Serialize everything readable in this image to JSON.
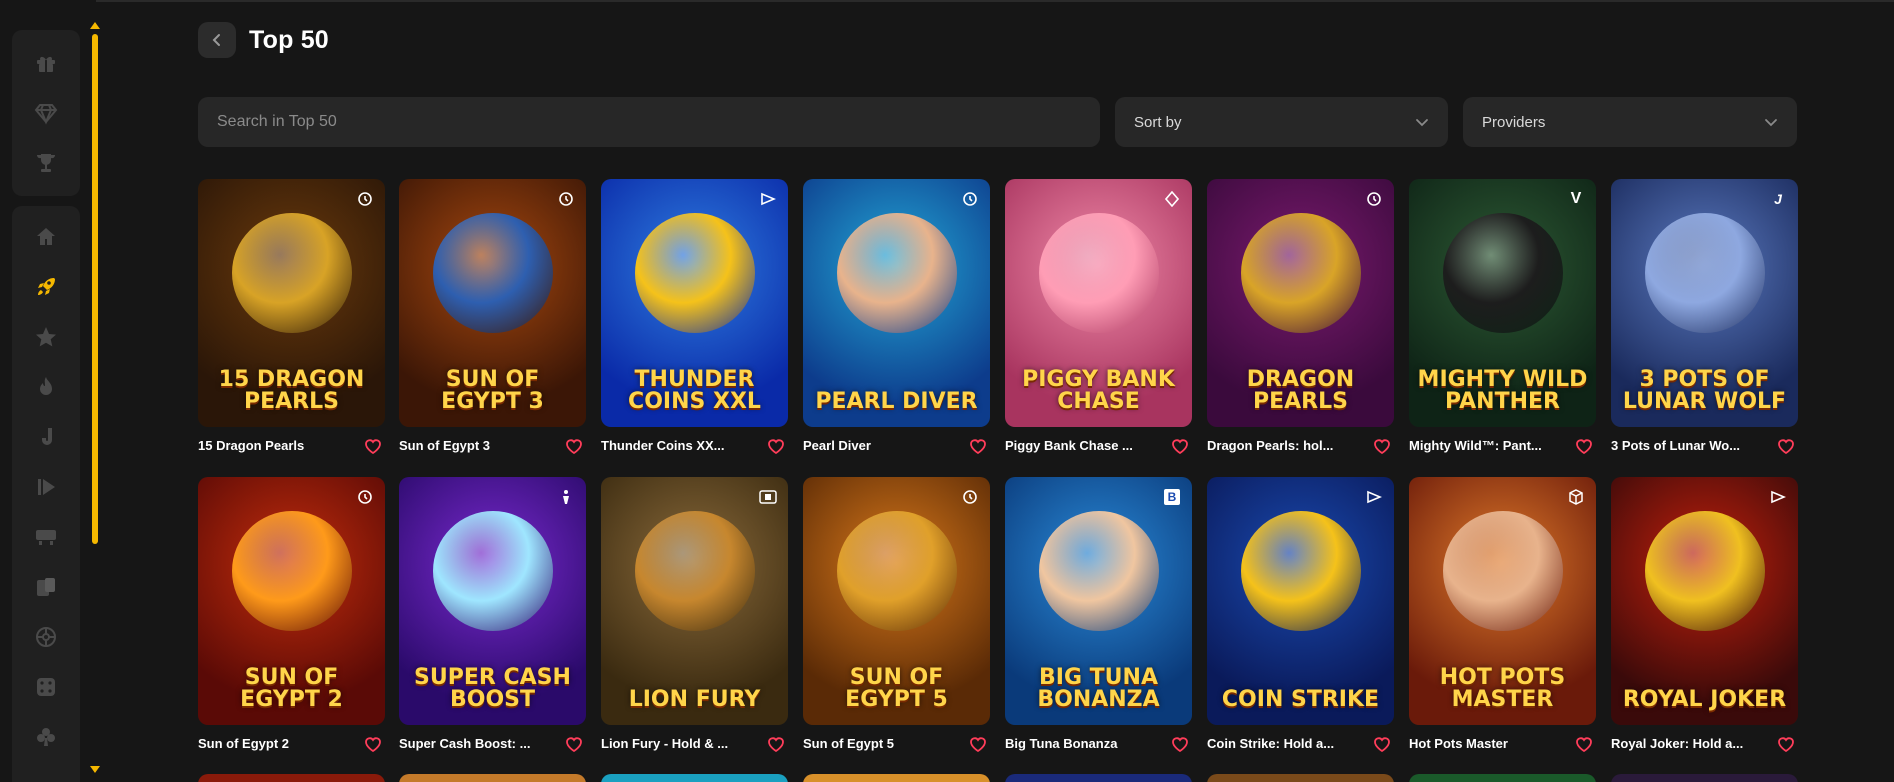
{
  "page": {
    "title": "Top 50"
  },
  "search": {
    "placeholder": "Search in Top 50"
  },
  "filters": {
    "sort_label": "Sort by",
    "providers_label": "Providers"
  },
  "sidebar": {
    "group1": [
      "gift-icon",
      "diamond-icon",
      "trophy-icon"
    ],
    "group2": [
      "home-icon",
      "rocket-icon",
      "star-icon",
      "fire-icon",
      "jackpot-icon",
      "live-icon",
      "table-games-icon",
      "cards-icon",
      "roulette-icon",
      "dice-icon",
      "clubs-icon"
    ],
    "active": "rocket-icon",
    "accent": "#f5b800"
  },
  "games": [
    {
      "name": "15 Dragon Pearls",
      "logo": "15 Dragon Pearls",
      "badge": "replay-icon",
      "bg": "#2a1608",
      "bg2": "#6b3a0b",
      "fig": "#d8a326"
    },
    {
      "name": "Sun of Egypt 3",
      "logo": "Sun of Egypt 3",
      "badge": "replay-icon",
      "bg": "#3b1606",
      "bg2": "#a7480f",
      "fig": "#2e5fb0"
    },
    {
      "name": "Thunder Coins XX...",
      "logo": "Thunder Coins XXL",
      "badge": "play-flag-icon",
      "bg": "#0a2aa8",
      "bg2": "#2f7de0",
      "fig": "#f5c21a"
    },
    {
      "name": "Pearl Diver",
      "logo": "Pearl Diver",
      "badge": "replay-icon",
      "bg": "#0d3c8c",
      "bg2": "#23a7d6",
      "fig": "#e8b38c"
    },
    {
      "name": "Piggy Bank Chase ...",
      "logo": "Piggy Bank Chase",
      "badge": "diamond-outline-icon",
      "bg": "#a8345f",
      "bg2": "#f08aa8",
      "fig": "#ff9db5"
    },
    {
      "name": "Dragon Pearls: hol...",
      "logo": "Dragon Pearls",
      "badge": "replay-icon",
      "bg": "#3a0a3c",
      "bg2": "#7a1a6e",
      "fig": "#d9a427"
    },
    {
      "name": "Mighty Wild™: Pant...",
      "logo": "Mighty Wild Panther",
      "badge": "v-letter-icon",
      "bg": "#0e2316",
      "bg2": "#2d5a34",
      "fig": "#1d1d1d"
    },
    {
      "name": "3 Pots of Lunar Wo...",
      "logo": "3 Pots of Lunar Wolf",
      "badge": "j-letter-icon",
      "bg": "#1a2a5c",
      "bg2": "#5b7ac0",
      "fig": "#8ea8e0"
    },
    {
      "name": "Sun of Egypt 2",
      "logo": "Sun of Egypt 2",
      "badge": "replay-icon",
      "bg": "#5a0a06",
      "bg2": "#c42d0c",
      "fig": "#ff9a1a"
    },
    {
      "name": "Super Cash Boost: ...",
      "logo": "Super Cash Boost",
      "badge": "player-icon",
      "bg": "#2a0a6a",
      "bg2": "#7a2ad0",
      "fig": "#9fe6ff"
    },
    {
      "name": "Lion Fury - Hold & ...",
      "logo": "Lion Fury",
      "badge": "film-icon",
      "bg": "#3a2a10",
      "bg2": "#8a6a3a",
      "fig": "#c7872e"
    },
    {
      "name": "Sun of Egypt 5",
      "logo": "Sun of Egypt 5",
      "badge": "replay-icon",
      "bg": "#5a2a06",
      "bg2": "#d8781a",
      "fig": "#e0a02a"
    },
    {
      "name": "Big Tuna Bonanza",
      "logo": "Big Tuna Bonanza",
      "badge": "b-letter-icon",
      "bg": "#0a3a7a",
      "bg2": "#2a8ad8",
      "fig": "#f0c6a0"
    },
    {
      "name": "Coin Strike: Hold a...",
      "logo": "Coin Strike",
      "badge": "play-flag-icon",
      "bg": "#0a1a5a",
      "bg2": "#1a4ab0",
      "fig": "#f5c21a"
    },
    {
      "name": "Hot Pots Master",
      "logo": "Hot Pots Master",
      "badge": "cube-icon",
      "bg": "#6a1a0a",
      "bg2": "#e07a2a",
      "fig": "#e8b38c"
    },
    {
      "name": "Royal Joker: Hold a...",
      "logo": "Royal Joker",
      "badge": "play-flag-icon",
      "bg": "#3a0a0a",
      "bg2": "#c4200c",
      "fig": "#f0c020"
    }
  ]
}
